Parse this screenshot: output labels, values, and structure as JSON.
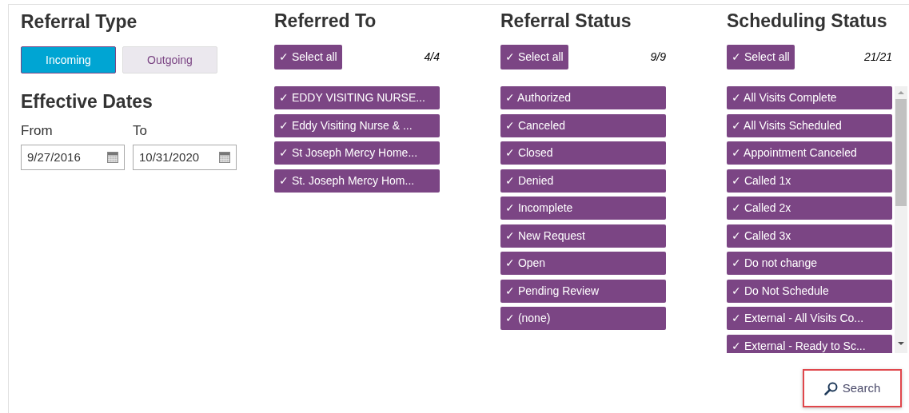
{
  "referral_type": {
    "title": "Referral Type",
    "options": [
      {
        "label": "Incoming",
        "selected": true
      },
      {
        "label": "Outgoing",
        "selected": false
      }
    ]
  },
  "effective_dates": {
    "title": "Effective Dates",
    "fields": [
      {
        "label": "From",
        "value": "9/27/2016"
      },
      {
        "label": "To",
        "value": "10/31/2020"
      }
    ]
  },
  "filters": [
    {
      "title": "Referred To",
      "select_all": {
        "label": "✓ Select all",
        "checked": true
      },
      "count": "4/4",
      "scrollable": false,
      "items": [
        {
          "label": "✓ EDDY VISITING NURSE...",
          "checked": true
        },
        {
          "label": "✓ Eddy Visiting Nurse & ...",
          "checked": true
        },
        {
          "label": "✓ St Joseph Mercy Home...",
          "checked": true
        },
        {
          "label": "✓ St. Joseph Mercy Hom...",
          "checked": true
        }
      ]
    },
    {
      "title": "Referral Status",
      "select_all": {
        "label": "✓ Select all",
        "checked": true
      },
      "count": "9/9",
      "scrollable": false,
      "items": [
        {
          "label": "✓ Authorized",
          "checked": true
        },
        {
          "label": "✓ Canceled",
          "checked": true
        },
        {
          "label": "✓ Closed",
          "checked": true
        },
        {
          "label": "✓ Denied",
          "checked": true
        },
        {
          "label": "✓ Incomplete",
          "checked": true
        },
        {
          "label": "✓ New Request",
          "checked": true
        },
        {
          "label": "✓ Open",
          "checked": true
        },
        {
          "label": "✓ Pending Review",
          "checked": true
        },
        {
          "label": "✓ (none)",
          "checked": true
        }
      ]
    },
    {
      "title": "Scheduling Status",
      "select_all": {
        "label": "✓ Select all",
        "checked": true
      },
      "count": "21/21",
      "scrollable": true,
      "items": [
        {
          "label": "✓ All Visits Complete",
          "checked": true
        },
        {
          "label": "✓ All Visits Scheduled",
          "checked": true
        },
        {
          "label": "✓ Appointment Canceled",
          "checked": true
        },
        {
          "label": "✓ Called 1x",
          "checked": true
        },
        {
          "label": "✓ Called 2x",
          "checked": true
        },
        {
          "label": "✓ Called 3x",
          "checked": true
        },
        {
          "label": "✓ Do not change",
          "checked": true
        },
        {
          "label": "✓ Do Not Schedule",
          "checked": true
        },
        {
          "label": "✓ External - All Visits Co...",
          "checked": true
        },
        {
          "label": "✓ External - Ready to Sc...",
          "checked": true
        }
      ]
    }
  ],
  "search_button": {
    "label": "Search",
    "highlighted": true
  }
}
